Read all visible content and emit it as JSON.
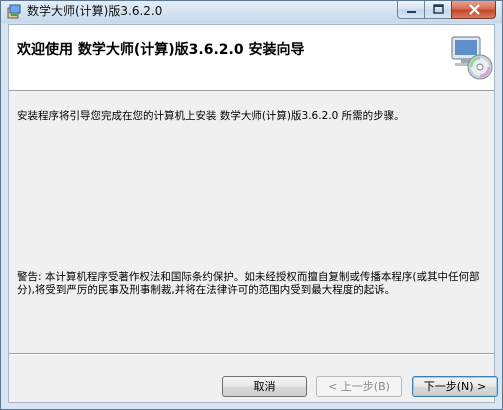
{
  "window": {
    "title": "数学大师(计算)版3.6.2.0",
    "icon": "installer-icon"
  },
  "banner": {
    "title": "欢迎使用 数学大师(计算)版3.6.2.0 安装向导",
    "graphic": "computer-cd-icon"
  },
  "body": {
    "intro": "安装程序将引导您完成在您的计算机上安装 数学大师(计算)版3.6.2.0 所需的步骤。",
    "warning": "警告: 本计算机程序受著作权法和国际条约保护。如未经授权而擅自复制或传播本程序(或其中任何部分),将受到严厉的民事及刑事制裁,并将在法律许可的范围内受到最大程度的起诉。"
  },
  "buttons": {
    "cancel": "取消",
    "prev": "< 上一步(B)",
    "next": "下一步(N) >"
  },
  "caption": {
    "minimize": "minimize-icon",
    "maximize": "maximize-icon",
    "close": "close-icon"
  }
}
